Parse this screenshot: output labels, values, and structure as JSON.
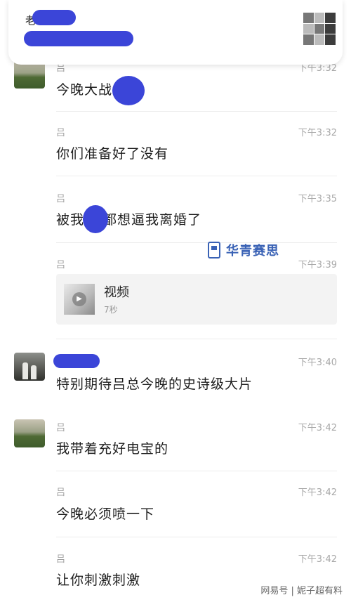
{
  "header": {
    "title_fragment": "老",
    "group_avatar_icon": "group-avatar-grid"
  },
  "watermark": {
    "icon": "phone-book-icon",
    "text": "华青赛思",
    "color": "#3a62b5"
  },
  "messages": [
    {
      "sender": "吕",
      "time": "下午3:32",
      "text": "今晚大战"
    },
    {
      "sender": "吕",
      "time": "下午3:32",
      "text": "你们准备好了没有"
    },
    {
      "sender": "吕",
      "time": "下午3:35",
      "text": "被我 的都想逼我离婚了"
    },
    {
      "sender": "吕",
      "time": "下午3:39",
      "video": {
        "title": "视频",
        "duration": "7秒"
      }
    },
    {
      "sender": "",
      "time": "下午3:40",
      "text": "特别期待吕总今晚的史诗级大片"
    },
    {
      "sender": "吕",
      "time": "下午3:42",
      "text": "我带着充好电宝的"
    },
    {
      "sender": "吕",
      "time": "下午3:42",
      "text": "今晚必须喷一下"
    },
    {
      "sender": "吕",
      "time": "下午3:42",
      "text": "让你刺激刺激"
    }
  ],
  "footer": {
    "source": "网易号 | 妮子超有料"
  },
  "colors": {
    "redaction": "#3b45d8",
    "time_text": "#a8a8a8"
  }
}
